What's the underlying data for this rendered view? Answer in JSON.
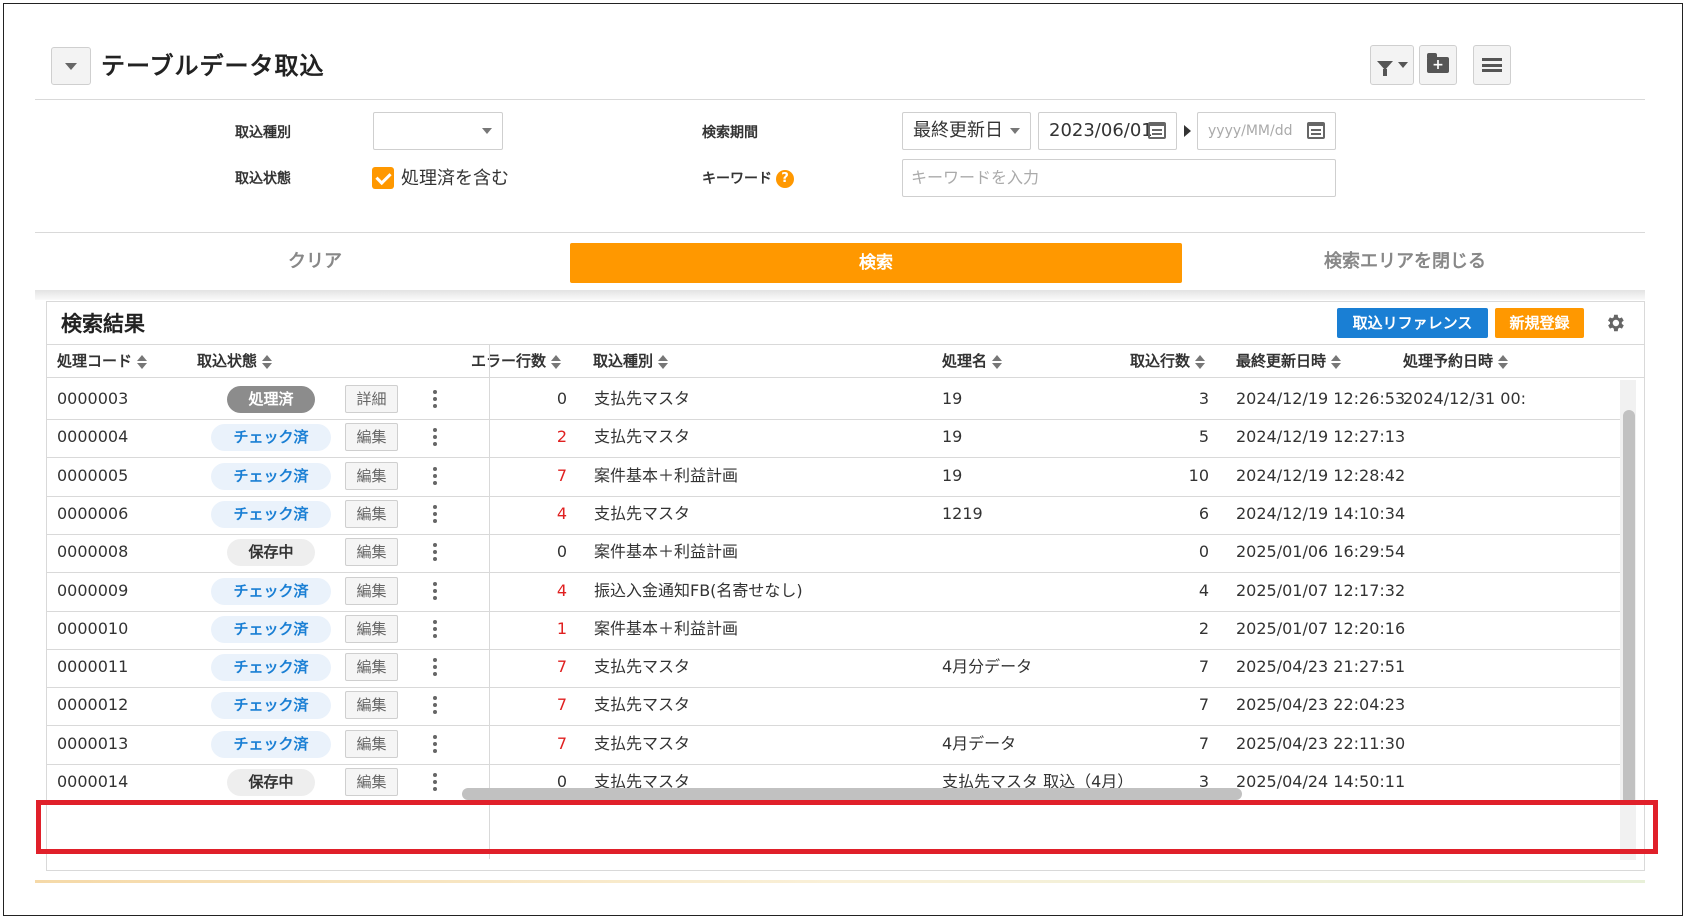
{
  "header": {
    "title": "テーブルデータ取込"
  },
  "form": {
    "import_type_label": "取込種別",
    "import_type_value": "",
    "import_status_label": "取込状態",
    "include_processed_label": "処理済を含む",
    "include_processed_checked": true,
    "period_label": "検索期間",
    "period_type": "最終更新日",
    "date_from": "2023/06/01",
    "date_to_placeholder": "yyyy/MM/dd",
    "keyword_label": "キーワード",
    "keyword_help": "?",
    "keyword_placeholder": "キーワードを入力"
  },
  "actions": {
    "clear": "クリア",
    "search": "検索",
    "close_search": "検索エリアを閉じる"
  },
  "results": {
    "title": "検索結果",
    "reference_button": "取込リファレンス",
    "new_button": "新規登録",
    "columns": [
      "処理コード",
      "取込状態",
      "エラー行数",
      "取込種別",
      "処理名",
      "取込行数",
      "最終更新日時",
      "処理予約日時"
    ],
    "rows": [
      {
        "code": "0000003",
        "status": "処理済",
        "status_kind": "done",
        "action": "詳細",
        "errors": "0",
        "type": "支払先マスタ",
        "name": "19",
        "count": "3",
        "updated": "2024/12/19 12:26:53",
        "scheduled": "2024/12/31 00:"
      },
      {
        "code": "0000004",
        "status": "チェック済",
        "status_kind": "check",
        "action": "編集",
        "errors": "2",
        "type": "支払先マスタ",
        "name": "19",
        "count": "5",
        "updated": "2024/12/19 12:27:13",
        "scheduled": ""
      },
      {
        "code": "0000005",
        "status": "チェック済",
        "status_kind": "check",
        "action": "編集",
        "errors": "7",
        "type": "案件基本＋利益計画",
        "name": "19",
        "count": "10",
        "updated": "2024/12/19 12:28:42",
        "scheduled": ""
      },
      {
        "code": "0000006",
        "status": "チェック済",
        "status_kind": "check",
        "action": "編集",
        "errors": "4",
        "type": "支払先マスタ",
        "name": "1219",
        "count": "6",
        "updated": "2024/12/19 14:10:34",
        "scheduled": ""
      },
      {
        "code": "0000008",
        "status": "保存中",
        "status_kind": "save",
        "action": "編集",
        "errors": "0",
        "type": "案件基本＋利益計画",
        "name": "",
        "count": "0",
        "updated": "2025/01/06 16:29:54",
        "scheduled": ""
      },
      {
        "code": "0000009",
        "status": "チェック済",
        "status_kind": "check",
        "action": "編集",
        "errors": "4",
        "type": "振込入金通知FB(名寄せなし)",
        "name": "",
        "count": "4",
        "updated": "2025/01/07 12:17:32",
        "scheduled": ""
      },
      {
        "code": "0000010",
        "status": "チェック済",
        "status_kind": "check",
        "action": "編集",
        "errors": "1",
        "type": "案件基本＋利益計画",
        "name": "",
        "count": "2",
        "updated": "2025/01/07 12:20:16",
        "scheduled": ""
      },
      {
        "code": "0000011",
        "status": "チェック済",
        "status_kind": "check",
        "action": "編集",
        "errors": "7",
        "type": "支払先マスタ",
        "name": "4月分データ",
        "count": "7",
        "updated": "2025/04/23 21:27:51",
        "scheduled": ""
      },
      {
        "code": "0000012",
        "status": "チェック済",
        "status_kind": "check",
        "action": "編集",
        "errors": "7",
        "type": "支払先マスタ",
        "name": "",
        "count": "7",
        "updated": "2025/04/23 22:04:23",
        "scheduled": ""
      },
      {
        "code": "0000013",
        "status": "チェック済",
        "status_kind": "check",
        "action": "編集",
        "errors": "7",
        "type": "支払先マスタ",
        "name": "4月データ",
        "count": "7",
        "updated": "2025/04/23 22:11:30",
        "scheduled": ""
      },
      {
        "code": "0000014",
        "status": "保存中",
        "status_kind": "save",
        "action": "編集",
        "errors": "0",
        "type": "支払先マスタ",
        "name": "支払先マスタ 取込（4月）",
        "count": "3",
        "updated": "2025/04/24 14:50:11",
        "scheduled": ""
      }
    ]
  },
  "colors": {
    "accent": "#ff9800",
    "primary": "#1a7fd4",
    "error": "#e02020",
    "highlight": "#e0202a"
  },
  "icons": [
    "chevron-down-icon",
    "filter-icon",
    "folder-plus-icon",
    "menu-icon",
    "calendar-icon",
    "help-icon",
    "sort-icon",
    "gear-icon",
    "kebab-icon",
    "checkbox-icon"
  ]
}
